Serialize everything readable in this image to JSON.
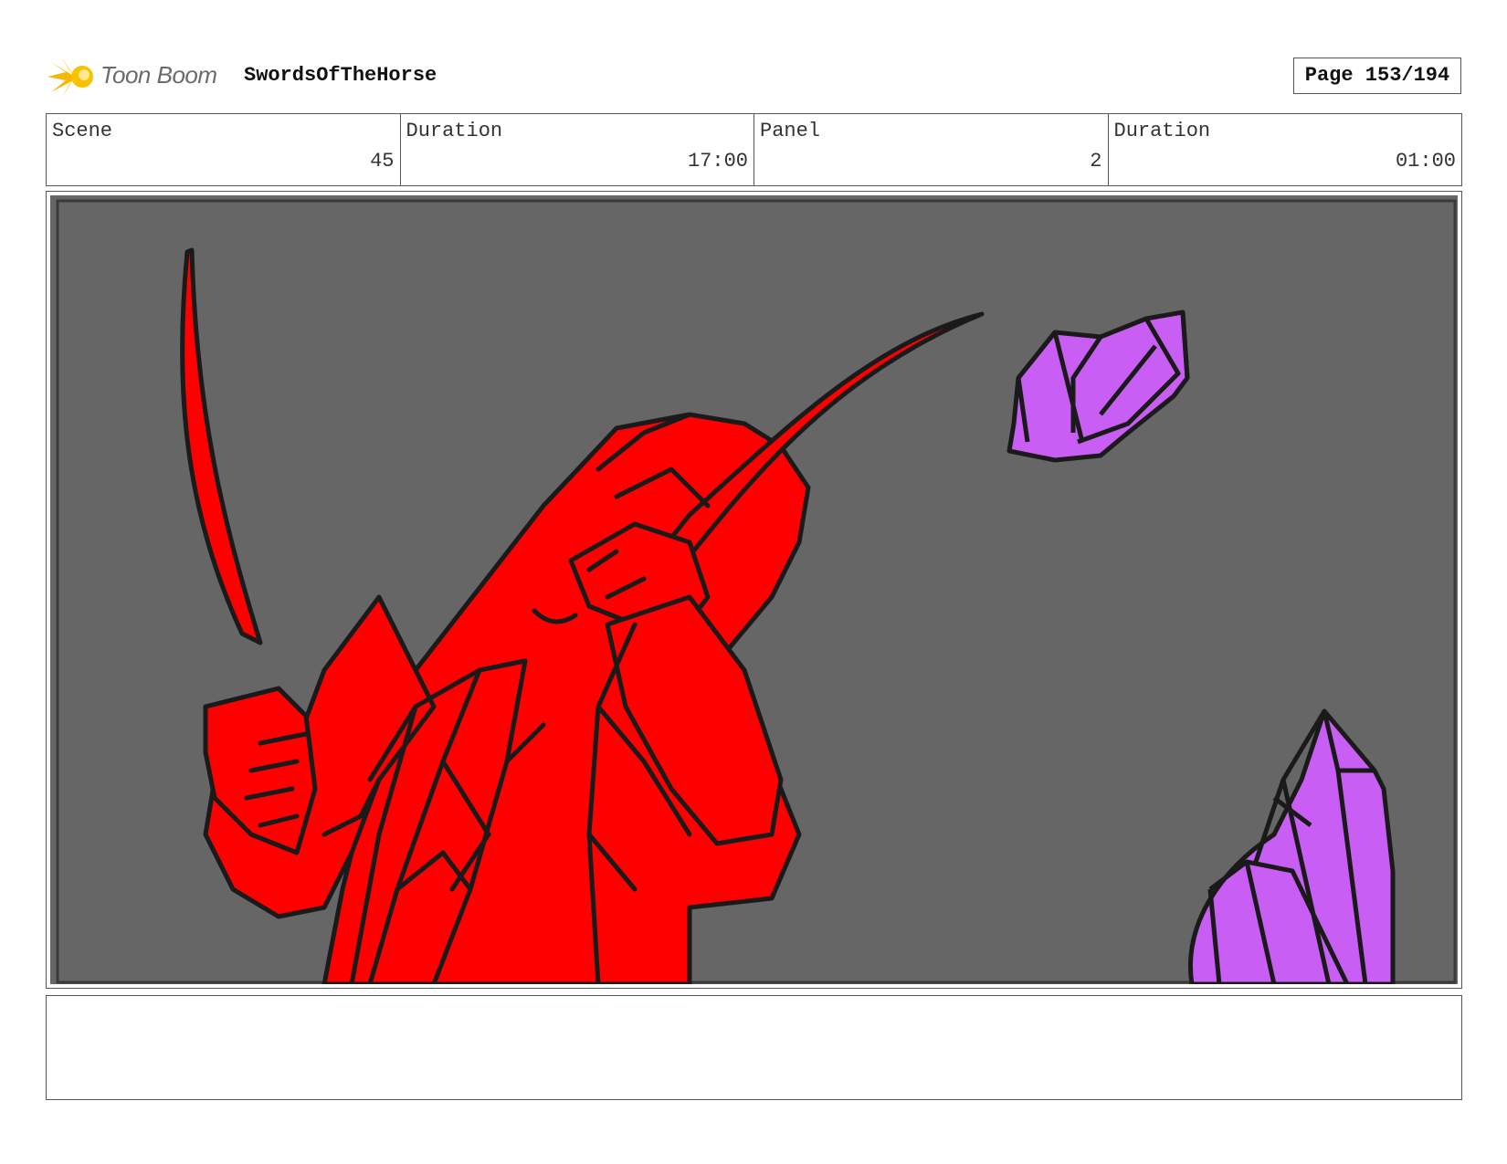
{
  "header": {
    "brand": "Toon Boom",
    "project_title": "SwordsOfTheHorse",
    "page_label": "Page 153/194"
  },
  "info": {
    "scene_label": "Scene",
    "scene_value": "45",
    "scene_duration_label": "Duration",
    "scene_duration_value": "17:00",
    "panel_label": "Panel",
    "panel_value": "2",
    "panel_duration_label": "Duration",
    "panel_duration_value": "01:00"
  },
  "panel": {
    "background_color": "#666666",
    "figure_color": "#ff0000",
    "crystal_color": "#c95ef5",
    "line_color": "#1a1a1a"
  },
  "notes": {
    "text": ""
  }
}
